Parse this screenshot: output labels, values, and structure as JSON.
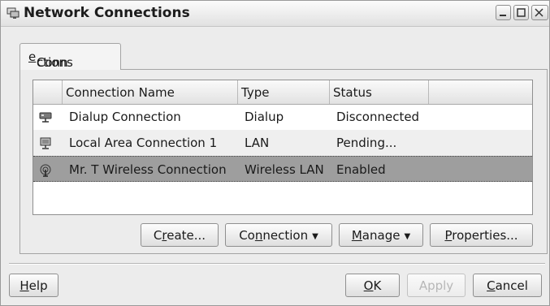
{
  "window": {
    "title": "Network Connections",
    "controls": [
      "minimize-icon",
      "maximize-icon",
      "close-icon"
    ]
  },
  "tabs": [
    {
      "pre": "Conn",
      "mnemonic": "e",
      "post": "ctions",
      "active": true
    }
  ],
  "table": {
    "headers": [
      "",
      "Connection Name",
      "Type",
      "Status"
    ],
    "rows": [
      {
        "icon": "dialup-modem-icon",
        "name": "Dialup Connection",
        "type": "Dialup",
        "status": "Disconnected",
        "selected": false
      },
      {
        "icon": "lan-monitor-icon",
        "name": "Local Area Connection 1",
        "type": "LAN",
        "status": "Pending...",
        "selected": false
      },
      {
        "icon": "wireless-antenna-icon",
        "name": "Mr. T Wireless Connection",
        "type": "Wireless LAN",
        "status": "Enabled",
        "selected": true
      }
    ]
  },
  "actions": {
    "create": {
      "pre": "C",
      "mnemonic": "r",
      "post": "eate..."
    },
    "connection": {
      "pre": "Co",
      "mnemonic": "n",
      "post": "nection"
    },
    "manage": {
      "pre": "",
      "mnemonic": "M",
      "post": "anage"
    },
    "properties": {
      "pre": "",
      "mnemonic": "P",
      "post": "roperties..."
    }
  },
  "dialog_buttons": {
    "help": {
      "pre": "",
      "mnemonic": "H",
      "post": "elp"
    },
    "ok": {
      "pre": "",
      "mnemonic": "O",
      "post": "K"
    },
    "apply": {
      "label": "Apply",
      "enabled": false
    },
    "cancel": {
      "pre": "",
      "mnemonic": "C",
      "post": "ancel"
    }
  },
  "colors": {
    "selected_row": "#9e9e9e",
    "alt_row": "#efefef",
    "window_bg": "#ececec"
  }
}
